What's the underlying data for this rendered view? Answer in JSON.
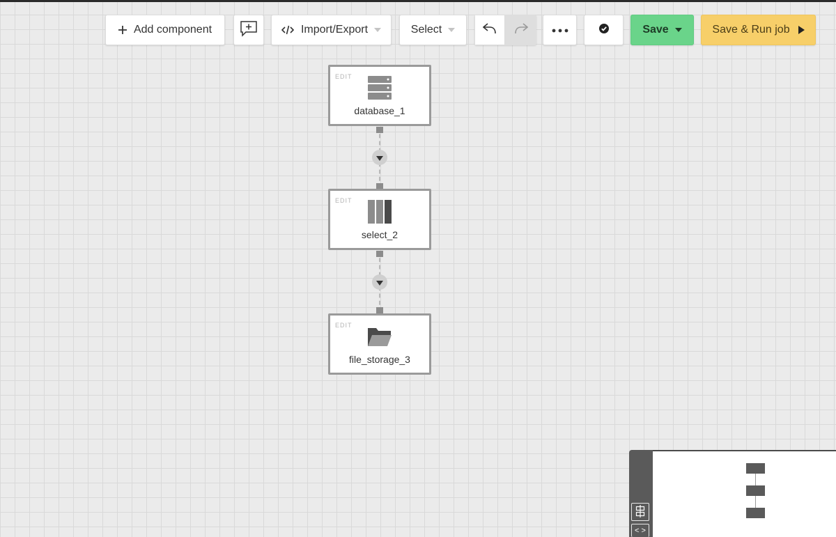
{
  "toolbar": {
    "add_component_label": "Add component",
    "import_export_label": "Import/Export",
    "select_label": "Select",
    "save_label": "Save",
    "save_run_label": "Save & Run job"
  },
  "pipeline": {
    "nodes": [
      {
        "edit_label": "EDIT",
        "name": "database_1",
        "icon": "database-icon"
      },
      {
        "edit_label": "EDIT",
        "name": "select_2",
        "icon": "select-columns-icon"
      },
      {
        "edit_label": "EDIT",
        "name": "file_storage_3",
        "icon": "folder-icon"
      }
    ]
  },
  "minimap": {
    "toggle_label": "< >"
  },
  "colors": {
    "save": "#6ad48a",
    "save_run": "#f7cf69",
    "node_border": "#9a9a9a",
    "canvas": "#ebebeb"
  }
}
